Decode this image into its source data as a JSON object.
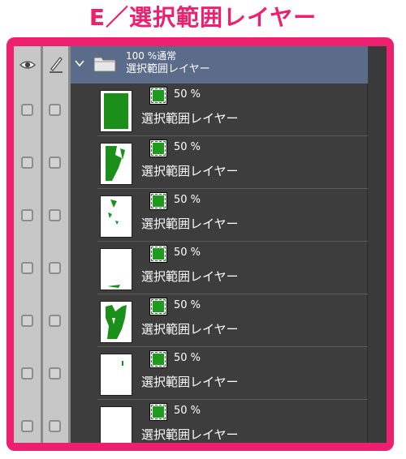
{
  "headline": "E／選択範囲レイヤー",
  "folder": {
    "opacity_blend": "100 %通常",
    "name": "選択範囲レイヤー"
  },
  "layers": [
    {
      "opacity": "50 %",
      "name": "選択範囲レイヤー"
    },
    {
      "opacity": "50 %",
      "name": "選択範囲レイヤー"
    },
    {
      "opacity": "50 %",
      "name": "選択範囲レイヤー"
    },
    {
      "opacity": "50 %",
      "name": "選択範囲レイヤー"
    },
    {
      "opacity": "50 %",
      "name": "選択範囲レイヤー"
    },
    {
      "opacity": "50 %",
      "name": "選択範囲レイヤー"
    },
    {
      "opacity": "50 %",
      "name": "選択範囲レイヤー"
    }
  ],
  "colors": {
    "accent": "#ee1f6f",
    "selection_green": "#1e9b1e",
    "folder_row": "#5b6b8a",
    "panel_bg": "#3d3d3d"
  },
  "icons": {
    "visibility": "eye-icon",
    "edit_lock": "pen-icon",
    "expand": "chevron-down-icon",
    "folder": "folder-icon",
    "layer_type": "selection-layer-icon"
  }
}
